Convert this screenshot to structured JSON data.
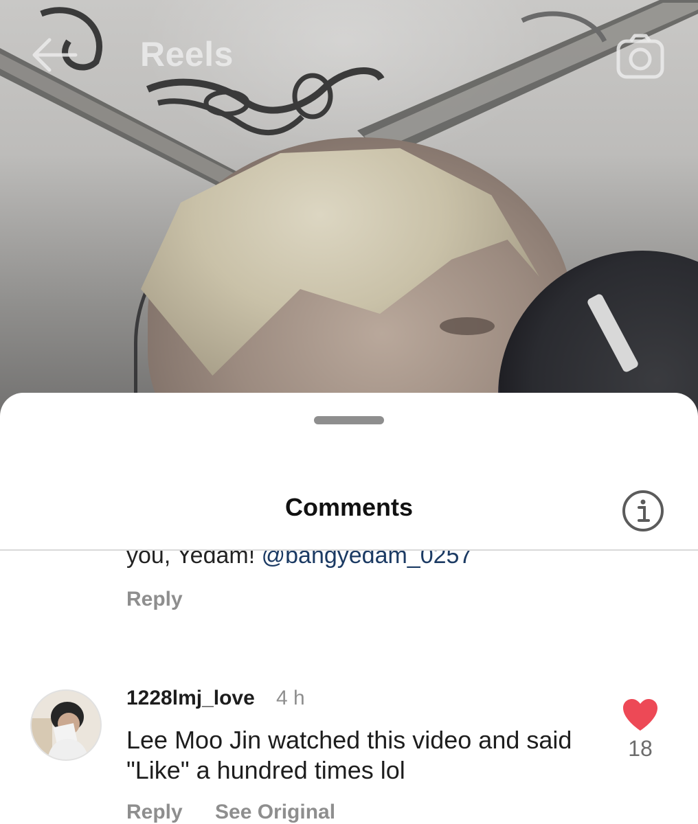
{
  "header": {
    "title": "Reels",
    "back_icon": "arrow-left-icon",
    "camera_icon": "camera-icon"
  },
  "sheet": {
    "title": "Comments",
    "info_icon": "info-icon"
  },
  "comments": [
    {
      "partial_text": "you, Yedam! ",
      "mention": "@bangyedam_0257",
      "reply_label": "Reply"
    },
    {
      "username": "1228lmj_love",
      "time": "4 h",
      "text": "Lee Moo Jin watched this video and said \"Like\" a hundred times lol",
      "like_count": "18",
      "reply_label": "Reply",
      "see_original_label": "See Original",
      "heart_color": "#ed4956"
    }
  ]
}
